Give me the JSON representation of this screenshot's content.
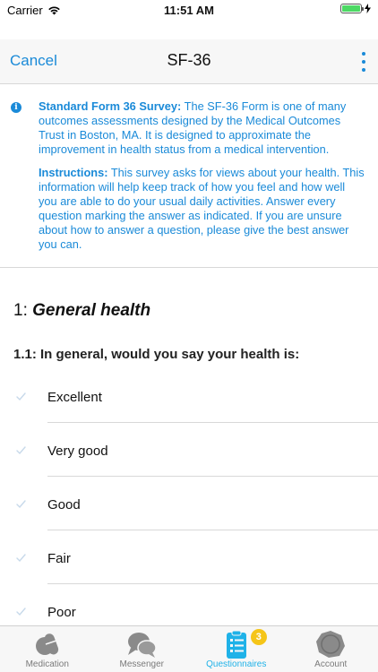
{
  "status_bar": {
    "carrier": "Carrier",
    "time": "11:51 AM",
    "battery_level": 1.0
  },
  "nav": {
    "cancel_label": "Cancel",
    "title": "SF-36",
    "more_icon": "vertical-ellipsis-icon"
  },
  "info": {
    "icon": "info-icon",
    "survey_heading": "Standard Form 36 Survey:",
    "survey_text": " The SF-36 Form is one of many outcomes assessments designed by the Medical Outcomes Trust in Boston, MA. It is designed to approximate the improvement in health status from a medical intervention.",
    "instructions_heading": "Instructions:",
    "instructions_text": " This survey asks for views about your health. This information will help keep track of how you feel and how well you are able to do your usual daily activities. Answer every question marking the answer as indicated. If you are unsure about how to answer a question, please give the best answer you can."
  },
  "section": {
    "number": "1: ",
    "title": "General health"
  },
  "question": {
    "text": "1.1: In general, would you say your health is:"
  },
  "options": [
    {
      "label": "Excellent"
    },
    {
      "label": "Very good"
    },
    {
      "label": "Good"
    },
    {
      "label": "Fair"
    },
    {
      "label": "Poor"
    }
  ],
  "tabs": [
    {
      "label": "Medication",
      "icon": "pills-icon",
      "active": false
    },
    {
      "label": "Messenger",
      "icon": "chat-bubbles-icon",
      "active": false
    },
    {
      "label": "Questionnaires",
      "icon": "clipboard-icon",
      "active": true,
      "badge": "3"
    },
    {
      "label": "Account",
      "icon": "account-icon",
      "active": false
    }
  ],
  "colors": {
    "accent": "#1a8ad8",
    "tab_active": "#1fb2e8",
    "badge": "#f5c518",
    "check": "#c7d9ea"
  }
}
